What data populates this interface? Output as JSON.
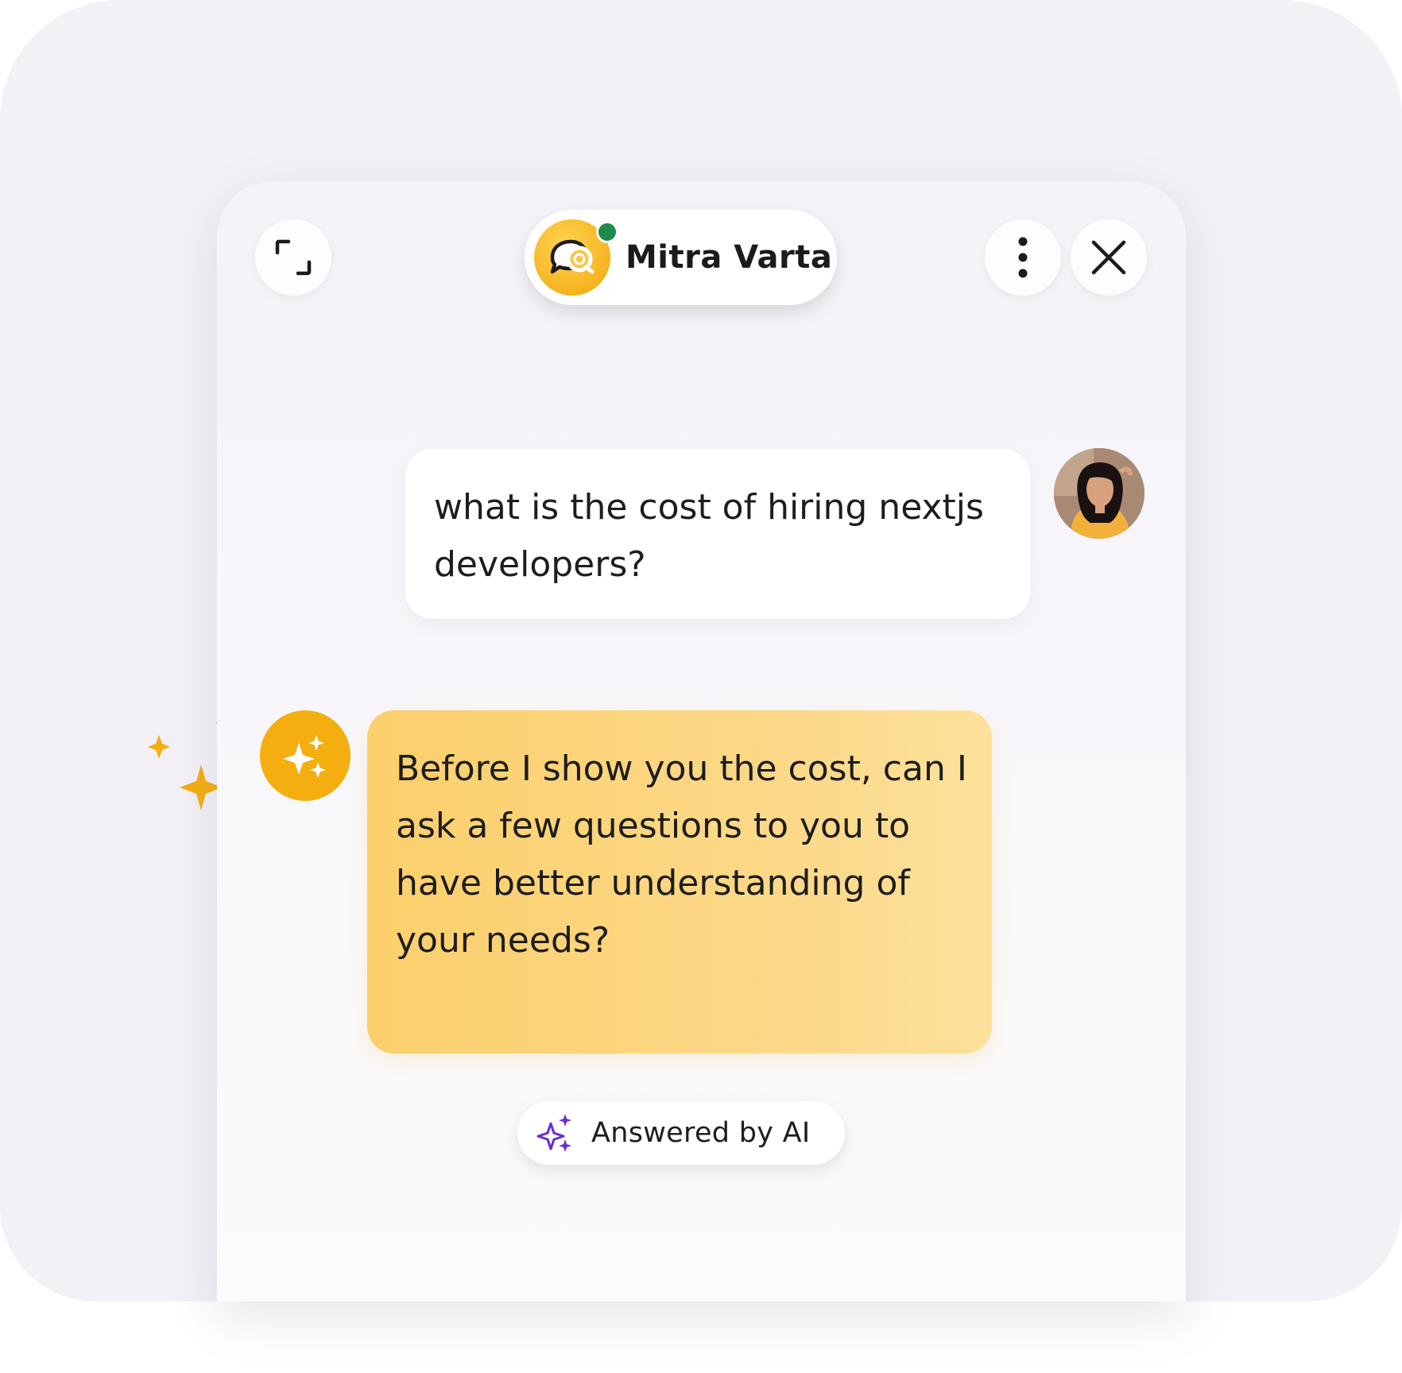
{
  "header": {
    "title": "Mitra Varta",
    "status": "online",
    "expand_icon": "expand-icon",
    "more_icon": "more-vertical-icon",
    "close_icon": "close-icon",
    "logo_icon": "chat-bubbles-logo-icon"
  },
  "messages": [
    {
      "sender": "user",
      "text": "what is the cost of hiring nextjs developers?",
      "avatar": "user-avatar"
    },
    {
      "sender": "bot",
      "text": "Before I show you the cost, can I ask a few questions to you to have better understanding of your needs?",
      "avatar": "ai-sparkle-icon"
    }
  ],
  "footer": {
    "ai_label": "Answered by AI",
    "ai_icon": "sparkle-icon"
  },
  "colors": {
    "accent": "#f5ae0f",
    "bot_bubble": "#fbcf6b",
    "online": "#1f8a4c",
    "ai_icon": "#6a2bd9",
    "background": "#f3f1f6"
  }
}
